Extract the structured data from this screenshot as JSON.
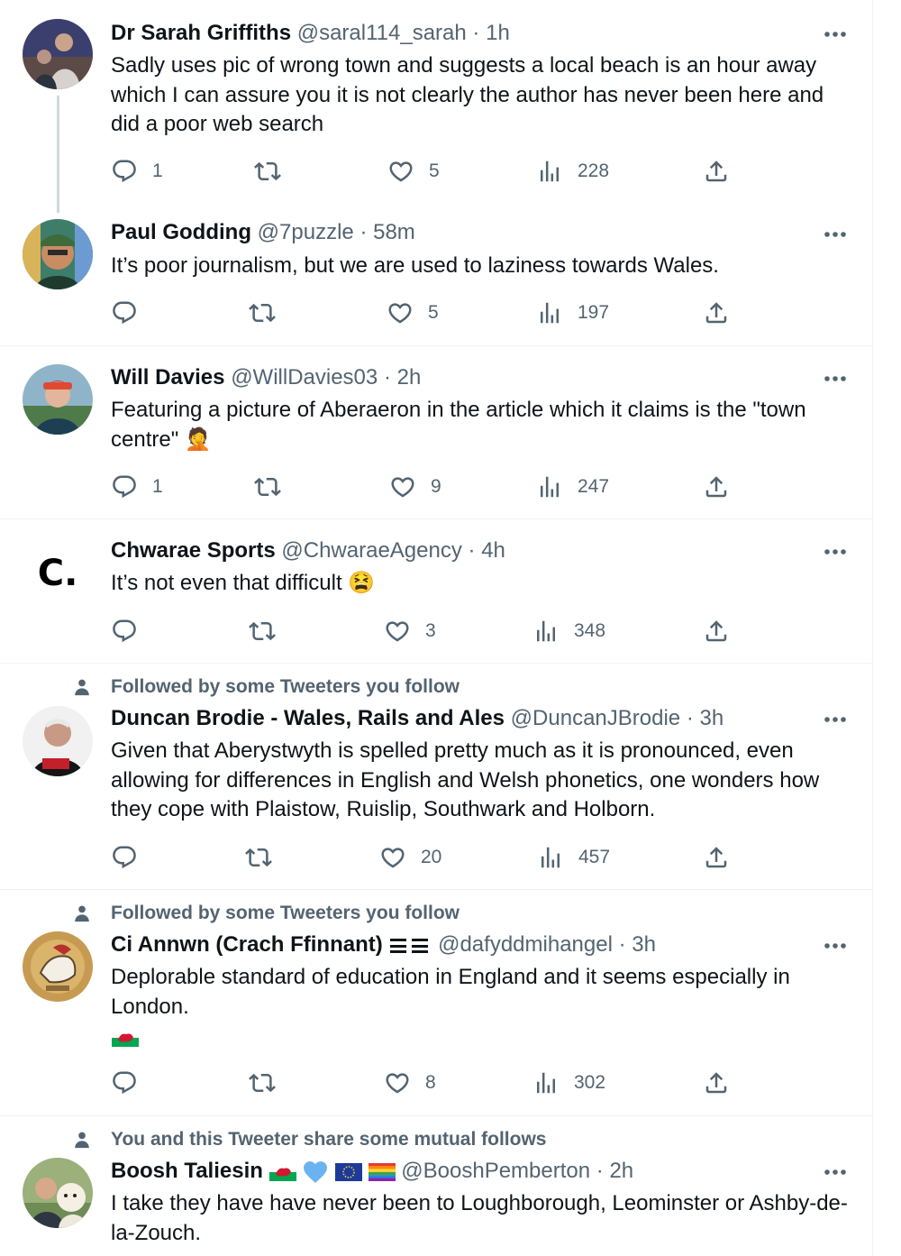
{
  "tweets": [
    {
      "name": "Dr Sarah Griffiths",
      "handle": "@saral114_sarah",
      "time": "1h",
      "text": "Sadly uses pic of wrong town and suggests a local beach is an hour away which I can assure you it is not clearly the author has never been here and did a poor web search",
      "replies": "1",
      "retweets": "",
      "likes": "5",
      "views": "228"
    },
    {
      "name": "Paul Godding",
      "handle": "@7puzzle",
      "time": "58m",
      "text": "It’s poor journalism, but we are used to laziness towards Wales.",
      "replies": "",
      "retweets": "",
      "likes": "5",
      "views": "197"
    },
    {
      "name": "Will Davies",
      "handle": "@WillDavies03",
      "time": "2h",
      "text": "Featuring a picture of Aberaeron in the article which it claims is the \"town centre\" 🤦",
      "replies": "1",
      "retweets": "",
      "likes": "9",
      "views": "247"
    },
    {
      "name": "Chwarae Sports",
      "handle": "@ChwaraeAgency",
      "time": "4h",
      "text": "It’s not even that difficult 😫",
      "avatar_text": "C.",
      "replies": "",
      "retweets": "",
      "likes": "3",
      "views": "348"
    },
    {
      "social": "Followed by some Tweeters you follow",
      "name": "Duncan Brodie - Wales, Rails and Ales",
      "handle": "@DuncanJBrodie",
      "time": "3h",
      "text": "Given that Aberystwyth is spelled pretty much as it is pronounced, even allowing for differences in English and Welsh phonetics, one wonders how they cope with Plaistow, Ruislip, Southwark and Holborn.",
      "replies": "",
      "retweets": "",
      "likes": "20",
      "views": "457"
    },
    {
      "social": "Followed by some Tweeters you follow",
      "name": "Ci Annwn (Crach Ffinnant)",
      "handle": "@dafyddmihangel",
      "time": "3h",
      "text": "Deplorable standard of education in England and it seems especially in London.",
      "replies": "",
      "retweets": "",
      "likes": "8",
      "views": "302"
    },
    {
      "social": "You and this Tweeter share some mutual follows",
      "name": "Boosh Taliesin",
      "handle": "@BooshPemberton",
      "time": "2h",
      "text": "I take they have have never been to Loughborough, Leominster or Ashby-de-la-Zouch."
    }
  ],
  "separator": "·",
  "icons": {
    "reply": "reply-icon",
    "retweet": "retweet-icon",
    "like": "heart-icon",
    "views": "views-icon",
    "share": "share-icon",
    "more": "more-icon",
    "social": "person-icon"
  },
  "colors": {
    "text": "#0f1419",
    "secondary": "#536471",
    "divider": "#eff3f4"
  }
}
